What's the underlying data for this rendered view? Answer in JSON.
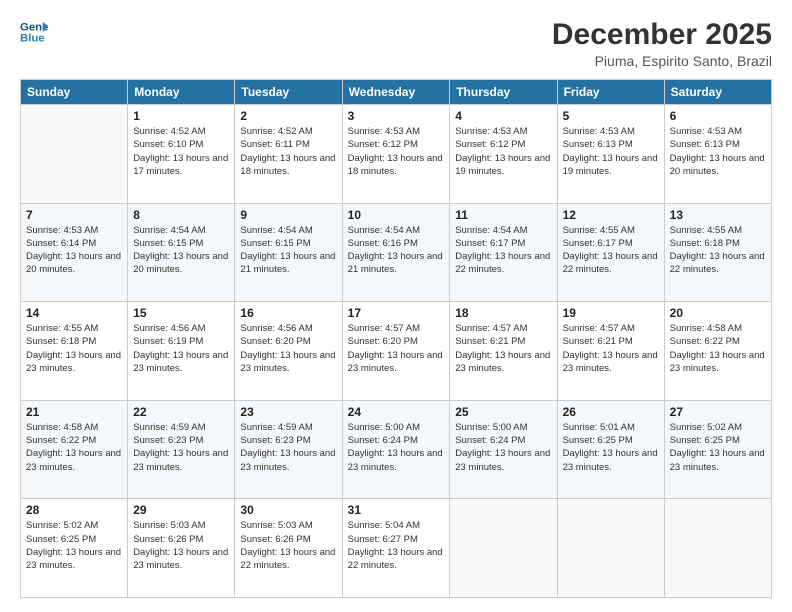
{
  "logo": {
    "line1": "General",
    "line2": "Blue"
  },
  "header": {
    "month": "December 2025",
    "location": "Piuma, Espirito Santo, Brazil"
  },
  "weekdays": [
    "Sunday",
    "Monday",
    "Tuesday",
    "Wednesday",
    "Thursday",
    "Friday",
    "Saturday"
  ],
  "weeks": [
    [
      {
        "day": "",
        "empty": true
      },
      {
        "day": "1",
        "sunrise": "4:52 AM",
        "sunset": "6:10 PM",
        "daylight": "13 hours and 17 minutes."
      },
      {
        "day": "2",
        "sunrise": "4:52 AM",
        "sunset": "6:11 PM",
        "daylight": "13 hours and 18 minutes."
      },
      {
        "day": "3",
        "sunrise": "4:53 AM",
        "sunset": "6:12 PM",
        "daylight": "13 hours and 18 minutes."
      },
      {
        "day": "4",
        "sunrise": "4:53 AM",
        "sunset": "6:12 PM",
        "daylight": "13 hours and 19 minutes."
      },
      {
        "day": "5",
        "sunrise": "4:53 AM",
        "sunset": "6:13 PM",
        "daylight": "13 hours and 19 minutes."
      },
      {
        "day": "6",
        "sunrise": "4:53 AM",
        "sunset": "6:13 PM",
        "daylight": "13 hours and 20 minutes."
      }
    ],
    [
      {
        "day": "7",
        "sunrise": "4:53 AM",
        "sunset": "6:14 PM",
        "daylight": "13 hours and 20 minutes."
      },
      {
        "day": "8",
        "sunrise": "4:54 AM",
        "sunset": "6:15 PM",
        "daylight": "13 hours and 20 minutes."
      },
      {
        "day": "9",
        "sunrise": "4:54 AM",
        "sunset": "6:15 PM",
        "daylight": "13 hours and 21 minutes."
      },
      {
        "day": "10",
        "sunrise": "4:54 AM",
        "sunset": "6:16 PM",
        "daylight": "13 hours and 21 minutes."
      },
      {
        "day": "11",
        "sunrise": "4:54 AM",
        "sunset": "6:17 PM",
        "daylight": "13 hours and 22 minutes."
      },
      {
        "day": "12",
        "sunrise": "4:55 AM",
        "sunset": "6:17 PM",
        "daylight": "13 hours and 22 minutes."
      },
      {
        "day": "13",
        "sunrise": "4:55 AM",
        "sunset": "6:18 PM",
        "daylight": "13 hours and 22 minutes."
      }
    ],
    [
      {
        "day": "14",
        "sunrise": "4:55 AM",
        "sunset": "6:18 PM",
        "daylight": "13 hours and 23 minutes."
      },
      {
        "day": "15",
        "sunrise": "4:56 AM",
        "sunset": "6:19 PM",
        "daylight": "13 hours and 23 minutes."
      },
      {
        "day": "16",
        "sunrise": "4:56 AM",
        "sunset": "6:20 PM",
        "daylight": "13 hours and 23 minutes."
      },
      {
        "day": "17",
        "sunrise": "4:57 AM",
        "sunset": "6:20 PM",
        "daylight": "13 hours and 23 minutes."
      },
      {
        "day": "18",
        "sunrise": "4:57 AM",
        "sunset": "6:21 PM",
        "daylight": "13 hours and 23 minutes."
      },
      {
        "day": "19",
        "sunrise": "4:57 AM",
        "sunset": "6:21 PM",
        "daylight": "13 hours and 23 minutes."
      },
      {
        "day": "20",
        "sunrise": "4:58 AM",
        "sunset": "6:22 PM",
        "daylight": "13 hours and 23 minutes."
      }
    ],
    [
      {
        "day": "21",
        "sunrise": "4:58 AM",
        "sunset": "6:22 PM",
        "daylight": "13 hours and 23 minutes."
      },
      {
        "day": "22",
        "sunrise": "4:59 AM",
        "sunset": "6:23 PM",
        "daylight": "13 hours and 23 minutes."
      },
      {
        "day": "23",
        "sunrise": "4:59 AM",
        "sunset": "6:23 PM",
        "daylight": "13 hours and 23 minutes."
      },
      {
        "day": "24",
        "sunrise": "5:00 AM",
        "sunset": "6:24 PM",
        "daylight": "13 hours and 23 minutes."
      },
      {
        "day": "25",
        "sunrise": "5:00 AM",
        "sunset": "6:24 PM",
        "daylight": "13 hours and 23 minutes."
      },
      {
        "day": "26",
        "sunrise": "5:01 AM",
        "sunset": "6:25 PM",
        "daylight": "13 hours and 23 minutes."
      },
      {
        "day": "27",
        "sunrise": "5:02 AM",
        "sunset": "6:25 PM",
        "daylight": "13 hours and 23 minutes."
      }
    ],
    [
      {
        "day": "28",
        "sunrise": "5:02 AM",
        "sunset": "6:25 PM",
        "daylight": "13 hours and 23 minutes."
      },
      {
        "day": "29",
        "sunrise": "5:03 AM",
        "sunset": "6:26 PM",
        "daylight": "13 hours and 23 minutes."
      },
      {
        "day": "30",
        "sunrise": "5:03 AM",
        "sunset": "6:26 PM",
        "daylight": "13 hours and 22 minutes."
      },
      {
        "day": "31",
        "sunrise": "5:04 AM",
        "sunset": "6:27 PM",
        "daylight": "13 hours and 22 minutes."
      },
      {
        "day": "",
        "empty": true
      },
      {
        "day": "",
        "empty": true
      },
      {
        "day": "",
        "empty": true
      }
    ]
  ]
}
